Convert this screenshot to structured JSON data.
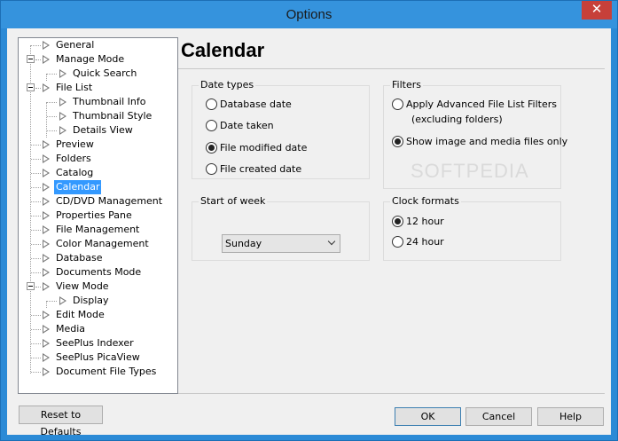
{
  "window": {
    "title": "Options",
    "close_glyph": "✕"
  },
  "tree": {
    "items": [
      {
        "label": "General"
      },
      {
        "label": "Manage Mode"
      },
      {
        "label": "Quick Search"
      },
      {
        "label": "File List"
      },
      {
        "label": "Thumbnail Info"
      },
      {
        "label": "Thumbnail Style"
      },
      {
        "label": "Details View"
      },
      {
        "label": "Preview"
      },
      {
        "label": "Folders"
      },
      {
        "label": "Catalog"
      },
      {
        "label": "Calendar"
      },
      {
        "label": "CD/DVD Management"
      },
      {
        "label": "Properties Pane"
      },
      {
        "label": "File Management"
      },
      {
        "label": "Color Management"
      },
      {
        "label": "Database"
      },
      {
        "label": "Documents Mode"
      },
      {
        "label": "View Mode"
      },
      {
        "label": "Display"
      },
      {
        "label": "Edit Mode"
      },
      {
        "label": "Media"
      },
      {
        "label": "SeePlus Indexer"
      },
      {
        "label": "SeePlus PicaView"
      },
      {
        "label": "Document File Types"
      }
    ],
    "selected": "Calendar"
  },
  "page": {
    "title": "Calendar"
  },
  "date_types": {
    "label": "Date types",
    "options": [
      "Database date",
      "Date taken",
      "File modified date",
      "File created date"
    ],
    "selected": "File modified date"
  },
  "filters": {
    "label": "Filters",
    "options": [
      "Apply Advanced File List Filters",
      "Show image and media files only"
    ],
    "option1_line2": "(excluding folders)",
    "selected": "Show image and media files only"
  },
  "start_of_week": {
    "label": "Start of week",
    "value": "Sunday"
  },
  "clock_formats": {
    "label": "Clock formats",
    "options": [
      "12 hour",
      "24 hour"
    ],
    "selected": "12 hour"
  },
  "watermark": "SOFTPEDIA",
  "buttons": {
    "reset": "Reset to Defaults",
    "ok": "OK",
    "cancel": "Cancel",
    "help": "Help"
  }
}
